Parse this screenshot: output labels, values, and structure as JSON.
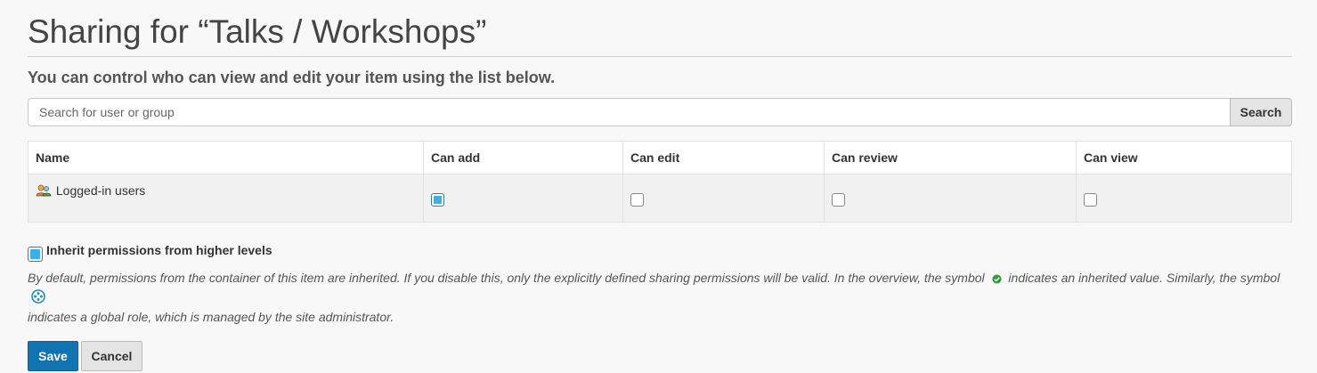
{
  "page": {
    "title": "Sharing for “Talks / Workshops”",
    "intro": "You can control who can view and edit your item using the list below."
  },
  "search": {
    "placeholder": "Search for user or group",
    "value": "",
    "button_label": "Search"
  },
  "table": {
    "columns": [
      "Name",
      "Can add",
      "Can edit",
      "Can review",
      "Can view"
    ],
    "rows": [
      {
        "name": "Logged-in users",
        "icon": "users-icon",
        "can_add": true,
        "can_edit": false,
        "can_review": false,
        "can_view": false
      }
    ]
  },
  "inherit": {
    "label": "Inherit permissions from higher levels",
    "checked": true,
    "help_part1": "By default, permissions from the container of this item are inherited. If you disable this, only the explicitly defined sharing permissions will be valid. In the overview, the symbol",
    "help_part2": "indicates an inherited value. Similarly, the symbol",
    "help_part3": "indicates a global role, which is managed by the site administrator.",
    "inherited_icon": "check-circle-icon",
    "global_icon": "global-role-icon"
  },
  "actions": {
    "save_label": "Save",
    "cancel_label": "Cancel"
  },
  "colors": {
    "primary": "#0f74b1",
    "checkbox_fill": "#3ab0e8",
    "inherited_green": "#2e9e3a"
  }
}
